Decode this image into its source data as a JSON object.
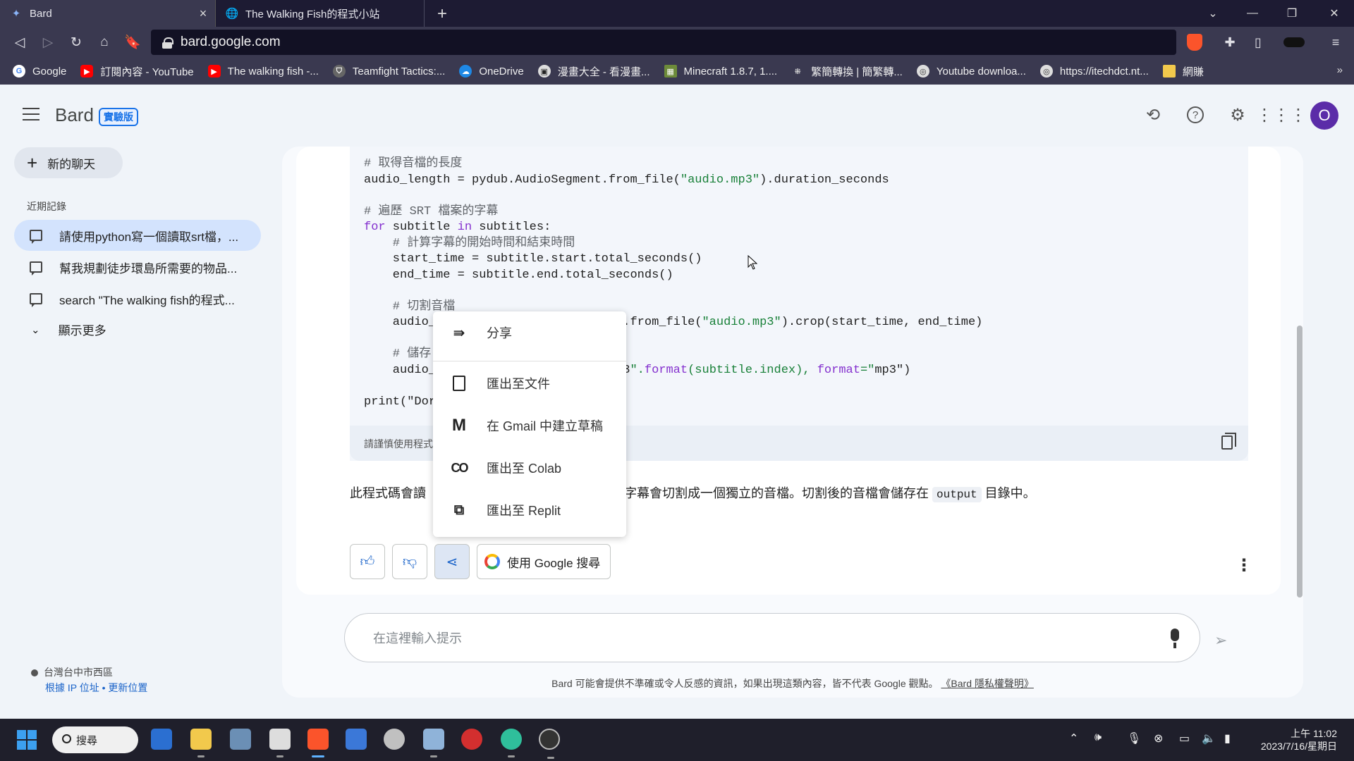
{
  "browser": {
    "tabs": [
      {
        "title": "Bard",
        "icon": "bard-sparkle-icon"
      },
      {
        "title": "The Walking Fish的程式小站",
        "icon": "globe-icon"
      }
    ],
    "url": "bard.google.com",
    "bookmarks": [
      {
        "label": "Google",
        "color": "#4285f4"
      },
      {
        "label": "訂閱內容 - YouTube",
        "color": "#ff0000"
      },
      {
        "label": "The walking fish -...",
        "color": "#ff0000"
      },
      {
        "label": "Teamfight Tactics:...",
        "color": "#888888"
      },
      {
        "label": "OneDrive",
        "color": "#1e88e5"
      },
      {
        "label": "漫畫大全 - 看漫畫...",
        "color": "#dddddd"
      },
      {
        "label": "Minecraft 1.8.7, 1....",
        "color": "#6d8b3a"
      },
      {
        "label": "繁簡轉換 | 簡繁轉...",
        "color": "#dddddd"
      },
      {
        "label": "Youtube downloa...",
        "color": "#dddddd"
      },
      {
        "label": "https://itechdct.nt...",
        "color": "#dddddd"
      },
      {
        "label": "網賺",
        "color": "#f2c94c"
      }
    ]
  },
  "header": {
    "brand": "Bard",
    "badge": "實驗版",
    "avatar_letter": "O"
  },
  "sidebar": {
    "new_chat": "新的聊天",
    "recent_heading": "近期記錄",
    "items": [
      {
        "label": "請使用python寫一個讀取srt檔，..."
      },
      {
        "label": "幫我規劃徒步環島所需要的物品..."
      },
      {
        "label": "search \"The walking fish的程式..."
      }
    ],
    "show_more": "顯示更多",
    "location": "台灣台中市西區",
    "location_links": "根據 IP 位址 • 更新位置"
  },
  "response": {
    "code_lines": [
      {
        "type": "cm",
        "text": "# 取得音檔的長度"
      },
      {
        "type": "plain",
        "text": "audio_length = pydub.AudioSegment.from_file(\"audio.mp3\").duration_seconds"
      },
      {
        "type": "plain",
        "text": ""
      },
      {
        "type": "cm",
        "text": "# 遍歷 SRT 檔案的字幕"
      },
      {
        "type": "for",
        "text": "for subtitle in subtitles:"
      },
      {
        "type": "cm",
        "text": "    # 計算字幕的開始時間和結束時間"
      },
      {
        "type": "plain",
        "text": "    start_time = subtitle.start.total_seconds()"
      },
      {
        "type": "plain",
        "text": "    end_time = subtitle.end.total_seconds()"
      },
      {
        "type": "plain",
        "text": ""
      },
      {
        "type": "cm",
        "text": "    # 切割音檔"
      },
      {
        "type": "plain",
        "text": "    audio_                          .from_file(\"audio.mp3\").crop(start_time, end_time)"
      },
      {
        "type": "plain",
        "text": ""
      },
      {
        "type": "cm",
        "text": "    # 儲存"
      },
      {
        "type": "plain",
        "text": "    audio_                          3\".format(subtitle.index), format=\"mp3\")"
      },
      {
        "type": "plain",
        "text": ""
      },
      {
        "type": "plain",
        "text": "print(\"Dor"
      }
    ],
    "code_note": "請謹慎使用程式",
    "paragraph_a": "此程式碼會讀",
    "paragraph_b": "字幕會切割成一個獨立的音檔。切割後的音檔會儲存在",
    "paragraph_code": "output",
    "paragraph_c": "目錄中。",
    "google_search": "使用 Google 搜尋"
  },
  "share_menu": {
    "items": [
      {
        "label": "分享",
        "icon": "share-arrow-icon"
      },
      {
        "label": "匯出至文件",
        "icon": "document-icon"
      },
      {
        "label": "在 Gmail 中建立草稿",
        "icon": "gmail-icon"
      },
      {
        "label": "匯出至 Colab",
        "icon": "colab-icon"
      },
      {
        "label": "匯出至 Replit",
        "icon": "replit-icon"
      }
    ]
  },
  "input": {
    "placeholder": "在這裡輸入提示"
  },
  "disclaimer": {
    "text": "Bard 可能會提供不準確或令人反感的資訊，如果出現這類內容，皆不代表 Google 觀點。",
    "link": "《Bard 隱私權聲明》"
  },
  "taskbar": {
    "search": "搜尋",
    "time": "上午 11:02",
    "date": "2023/7/16/星期日"
  }
}
